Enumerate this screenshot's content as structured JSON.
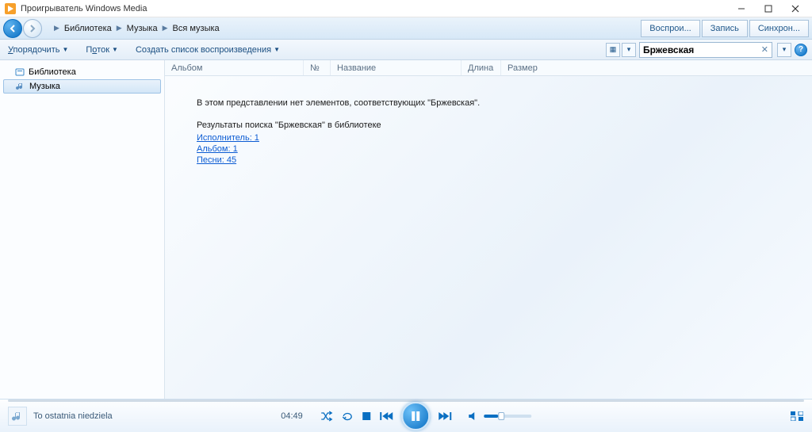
{
  "window": {
    "title": "Проигрыватель Windows Media"
  },
  "breadcrumb": {
    "items": [
      "Библиотека",
      "Музыка",
      "Вся музыка"
    ]
  },
  "nav_tabs": {
    "play": "Воспрои...",
    "burn": "Запись",
    "sync": "Синхрон..."
  },
  "toolbar": {
    "organize": "Упорядочить",
    "stream": "Поток",
    "create_playlist": "Создать список воспроизведения",
    "search_value": "Бржевская"
  },
  "sidebar": {
    "library": "Библиотека",
    "music": "Музыка"
  },
  "columns": {
    "album": "Альбом",
    "num": "№",
    "title": "Название",
    "length": "Длина",
    "size": "Размер"
  },
  "results": {
    "no_items": "В этом представлении нет элементов, соответствующих \"Бржевская\".",
    "heading": "Результаты поиска \"Бржевская\" в библиотеке",
    "artist": "Исполнитель: 1",
    "album": "Альбом: 1",
    "songs": "Песни: 45"
  },
  "player": {
    "track": "To ostatnia niedziela",
    "time": "04:49"
  }
}
